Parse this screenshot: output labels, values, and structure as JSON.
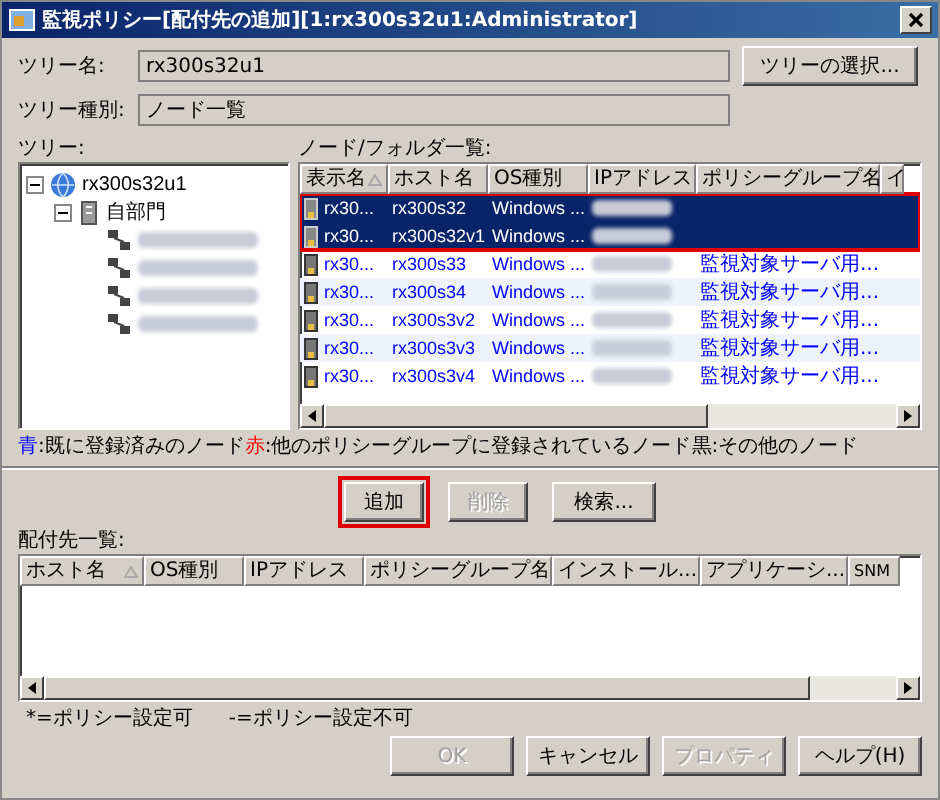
{
  "window": {
    "title": "監視ポリシー[配付先の追加][1:rx300s32u1:Administrator]"
  },
  "tree_name": {
    "label": "ツリー名:",
    "value": "rx300s32u1"
  },
  "select_tree_button": "ツリーの選択...",
  "tree_type": {
    "label": "ツリー種別:",
    "value": "ノード一覧"
  },
  "tree": {
    "label": "ツリー:",
    "root": {
      "label": "rx300s32u1",
      "expanded": true,
      "children": [
        {
          "label": "自部門",
          "expanded": true,
          "children": [
            {
              "kind": "blurred"
            },
            {
              "kind": "blurred"
            },
            {
              "kind": "blurred"
            },
            {
              "kind": "blurred"
            }
          ]
        }
      ]
    }
  },
  "node_list": {
    "label": "ノード/フォルダ一覧:",
    "columns": [
      {
        "label": "表示名",
        "sorted": true
      },
      {
        "label": "ホスト名",
        "sorted": false
      },
      {
        "label": "OS種別",
        "sorted": false
      },
      {
        "label": "IPアドレス",
        "sorted": false
      },
      {
        "label": "ポリシーグループ名",
        "sorted": false
      },
      {
        "label": "イ",
        "sorted": false
      }
    ],
    "rows": [
      {
        "display_name": "rx30...",
        "host": "rx300s32",
        "os": "Windows ...",
        "selected": true
      },
      {
        "display_name": "rx30...",
        "host": "rx300s32v1",
        "os": "Windows ...",
        "selected": true
      },
      {
        "display_name": "rx30...",
        "host": "rx300s33",
        "os": "Windows ...",
        "policy_group": "監視対象サーバ用...",
        "selected": false,
        "color": "#0000ff"
      },
      {
        "display_name": "rx30...",
        "host": "rx300s34",
        "os": "Windows ...",
        "policy_group": "監視対象サーバ用...",
        "selected": false,
        "color": "#0000ff"
      },
      {
        "display_name": "rx30...",
        "host": "rx300s3v2",
        "os": "Windows ...",
        "policy_group": "監視対象サーバ用...",
        "selected": false,
        "color": "#0000ff"
      },
      {
        "display_name": "rx30...",
        "host": "rx300s3v3",
        "os": "Windows ...",
        "policy_group": "監視対象サーバ用...",
        "selected": false,
        "color": "#0000ff"
      },
      {
        "display_name": "rx30...",
        "host": "rx300s3v4",
        "os": "Windows ...",
        "policy_group": "監視対象サーバ用...",
        "selected": false,
        "color": "#0000ff"
      }
    ]
  },
  "legend": [
    {
      "key": "青",
      "color": "#0000ff",
      "text": ":既に登録済みのノード"
    },
    {
      "key": "赤",
      "color": "#ff0000",
      "text": ":他のポリシーグループに登録されているノード"
    },
    {
      "key": "黒",
      "color": "#000000",
      "text": ":その他のノード"
    }
  ],
  "action_buttons": [
    {
      "label": "追加",
      "disabled": false,
      "highlighted": true
    },
    {
      "label": "削除",
      "disabled": true,
      "highlighted": false
    },
    {
      "label": "検索...",
      "disabled": false,
      "highlighted": false
    }
  ],
  "targets": {
    "label": "配付先一覧:",
    "columns": [
      {
        "label": "ホスト名",
        "sorted": true
      },
      {
        "label": "OS種別",
        "sorted": false
      },
      {
        "label": "IPアドレス",
        "sorted": false
      },
      {
        "label": "ポリシーグループ名",
        "sorted": false
      },
      {
        "label": "インストール...",
        "sorted": false
      },
      {
        "label": "アプリケーシ...",
        "sorted": false
      },
      {
        "label": "SNM",
        "sorted": false
      }
    ]
  },
  "notes": [
    "*=ポリシー設定可",
    "-=ポリシー設定不可"
  ],
  "dialog_buttons": [
    {
      "label": "OK",
      "disabled": true
    },
    {
      "label": "キャンセル",
      "disabled": false
    },
    {
      "label": "プロパティ",
      "disabled": true
    },
    {
      "label": "ヘルプ(H)",
      "disabled": false
    }
  ]
}
